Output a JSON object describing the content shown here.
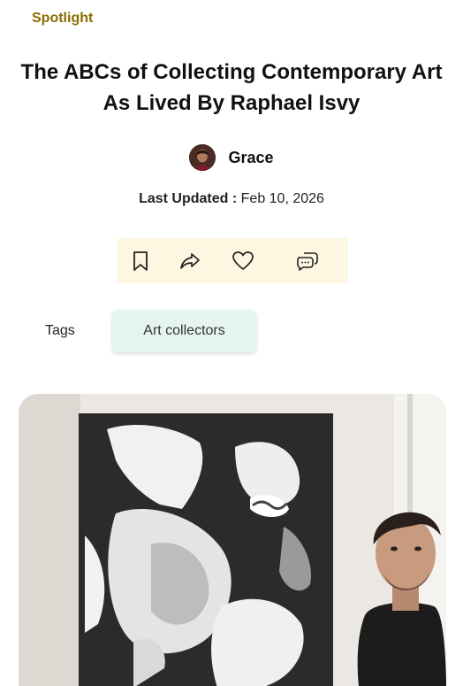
{
  "kicker": "Spotlight",
  "article": {
    "title": "The ABCs of Collecting Contemporary Art As Lived By Raphael Isvy",
    "author": "Grace",
    "updated_label": "Last Updated :",
    "updated_date": "Feb 10, 2026"
  },
  "actions": {
    "icons": [
      "bookmark-icon",
      "share-icon",
      "heart-icon",
      "comments-icon"
    ],
    "background": "#fdf6e0"
  },
  "tags": {
    "label": "Tags",
    "items": [
      "Art collectors"
    ],
    "chip_color": "#e6f4ee"
  },
  "colors": {
    "kicker": "#8a6d00",
    "text": "#111111"
  }
}
